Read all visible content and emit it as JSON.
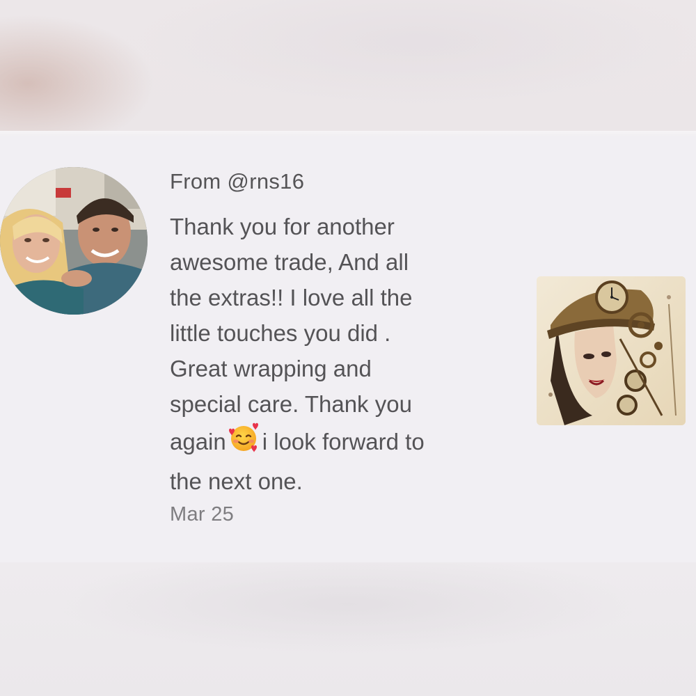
{
  "review": {
    "from_label": "From @rns16",
    "message_lines": [
      "Thank you for another",
      "awesome trade, And all",
      "the extras!! I love all the",
      "little touches you did .",
      "Great wrapping and",
      "special care. Thank you"
    ],
    "line7_before": "again",
    "line7_after": "i look forward to",
    "line8": "the next one.",
    "emoji": "smiling-face-with-hearts-emoji",
    "date": "Mar 25"
  },
  "avatar": {
    "icon": "user-avatar-photo"
  },
  "thumbnail": {
    "icon": "steampunk-woman-artwork"
  }
}
